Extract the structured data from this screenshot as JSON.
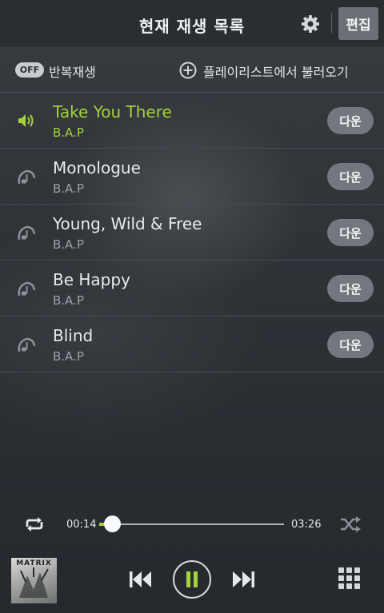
{
  "header": {
    "title": "현재 재생 목록",
    "edit_label": "편집",
    "settings_icon": "gear-icon"
  },
  "toolbar": {
    "repeat_state": "OFF",
    "repeat_label": "반복재생",
    "load_playlist_label": "플레이리스트에서 불러오기",
    "load_icon": "plus-circle-icon"
  },
  "tracks": [
    {
      "title": "Take You There",
      "artist": "B.A.P",
      "down_label": "다운",
      "playing": true
    },
    {
      "title": "Monologue",
      "artist": "B.A.P",
      "down_label": "다운",
      "playing": false
    },
    {
      "title": "Young, Wild & Free",
      "artist": "B.A.P",
      "down_label": "다운",
      "playing": false
    },
    {
      "title": "Be Happy",
      "artist": "B.A.P",
      "down_label": "다운",
      "playing": false
    },
    {
      "title": "Blind",
      "artist": "B.A.P",
      "down_label": "다운",
      "playing": false
    }
  ],
  "player": {
    "current_time": "00:14",
    "total_time": "03:26",
    "progress": 0.068,
    "album_art_text": "MATRIX",
    "state": "playing"
  },
  "colors": {
    "accent": "#a3d23a",
    "background": "#2b3036",
    "button": "#73787e"
  }
}
